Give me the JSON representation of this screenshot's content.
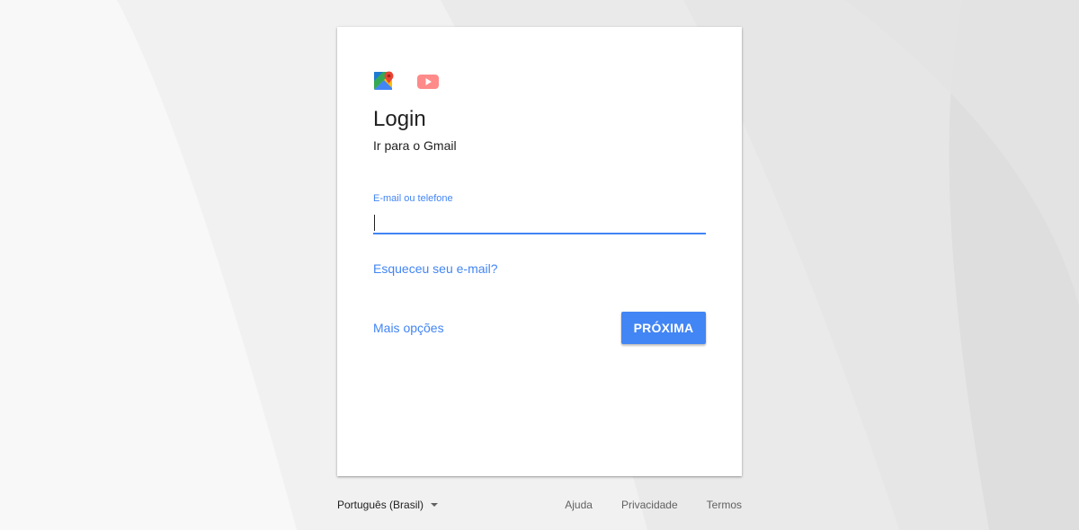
{
  "card": {
    "title": "Login",
    "subtitle": "Ir para o Gmail",
    "email_field": {
      "label": "E-mail ou telefone",
      "value": "",
      "placeholder": ""
    },
    "forgot_email_link": "Esqueceu seu e-mail?",
    "more_options_link": "Mais opções",
    "next_button": "PRÓXIMA",
    "app_icons": [
      "maps-icon",
      "youtube-icon"
    ]
  },
  "footer": {
    "language": "Português (Brasil)",
    "links": [
      "Ajuda",
      "Privacidade",
      "Termos"
    ]
  },
  "colors": {
    "accent": "#4285f4",
    "background": "#f1f1f1",
    "card": "#ffffff",
    "text": "#212121",
    "muted_text": "#616161"
  }
}
